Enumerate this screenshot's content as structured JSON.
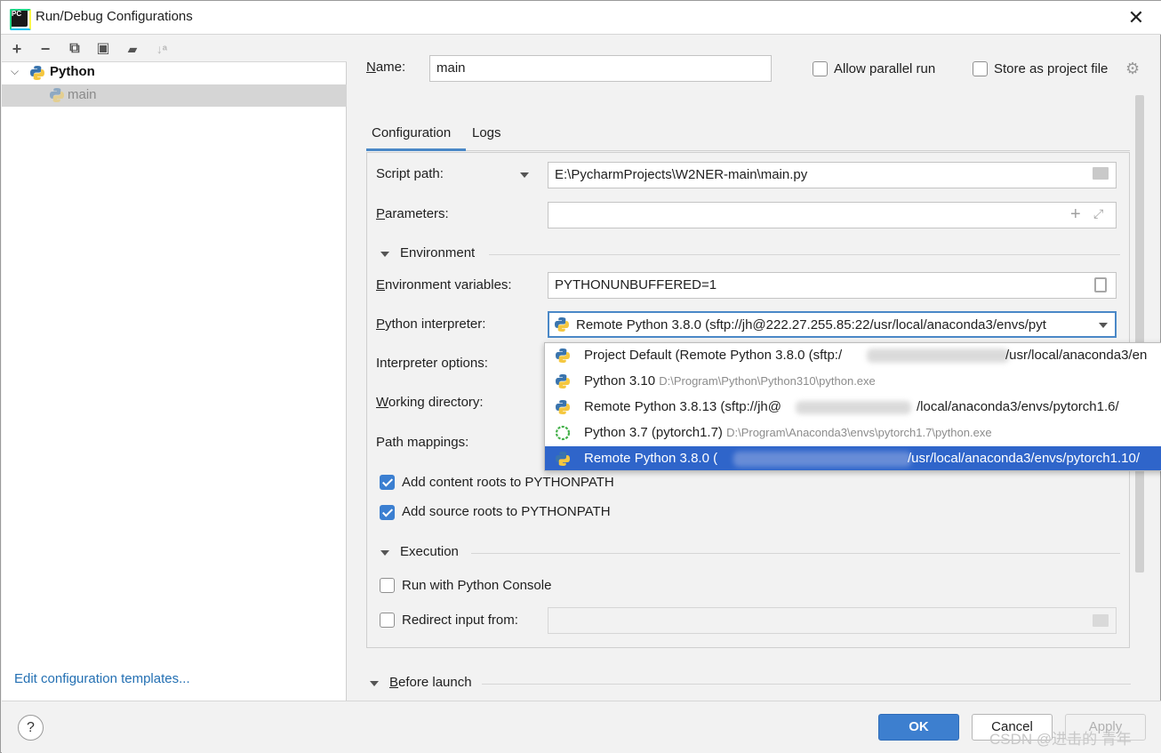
{
  "window": {
    "title": "Run/Debug Configurations",
    "close_glyph": "✕",
    "app_icon_text": "PC"
  },
  "left": {
    "toolbar": [
      {
        "name": "add-icon",
        "glyph": "+"
      },
      {
        "name": "remove-icon",
        "glyph": "−"
      },
      {
        "name": "copy-icon",
        "glyph": "⧉"
      },
      {
        "name": "save-icon",
        "glyph": "▣"
      },
      {
        "name": "new-folder-icon",
        "glyph": "▰"
      },
      {
        "name": "sort-icon",
        "glyph": "↓ᵃ"
      }
    ],
    "tree": {
      "group": "Python",
      "item": "main"
    },
    "templates_link": "Edit configuration templates..."
  },
  "form": {
    "name_label": "Name:",
    "name_value": "main",
    "allow_parallel": "Allow parallel run",
    "store_project": "Store as project file",
    "tabs": [
      "Configuration",
      "Logs"
    ],
    "script_path_label": "Script path:",
    "script_path_value": "E:\\PycharmProjects\\W2NER-main\\main.py",
    "parameters_label": "Parameters:",
    "parameters_value": "",
    "environment_section": "Environment",
    "env_vars_label": "Environment variables:",
    "env_vars_value": "PYTHONUNBUFFERED=1",
    "interpreter_label": "Python interpreter:",
    "interpreter_value": "Remote Python 3.8.0 (sftp://jh@222.27.255.85:22/usr/local/anaconda3/envs/pyt",
    "interpreter_options_label": "Interpreter options:",
    "working_dir_label": "Working directory:",
    "path_mappings_label": "Path mappings:",
    "content_roots": "Add content roots to PYTHONPATH",
    "source_roots": "Add source roots to PYTHONPATH",
    "execution_section": "Execution",
    "run_console": "Run with Python Console",
    "redirect_input": "Redirect input from:",
    "before_launch": "Before launch"
  },
  "dropdown": [
    {
      "name": "Project Default (Remote Python 3.8.0 (sftp:/",
      "path": "",
      "tail": "/usr/local/anaconda3/en",
      "icon": "remote",
      "blur": true,
      "selected": false
    },
    {
      "name": "Python 3.10",
      "path": "D:\\Program\\Python\\Python310\\python.exe",
      "tail": "",
      "icon": "python",
      "blur": false,
      "selected": false
    },
    {
      "name": "Remote Python 3.8.13 (sftp://jh@",
      "path": "",
      "tail": "/local/anaconda3/envs/pytorch1.6/",
      "icon": "remote",
      "blur": true,
      "selected": false
    },
    {
      "name": "Python 3.7 (pytorch1.7)",
      "path": "D:\\Program\\Anaconda3\\envs\\pytorch1.7\\python.exe",
      "tail": "",
      "icon": "conda",
      "blur": false,
      "selected": false
    },
    {
      "name": "Remote Python 3.8.0 (",
      "path": "",
      "tail": "/usr/local/anaconda3/envs/pytorch1.10/",
      "icon": "remote",
      "blur": true,
      "selected": true
    }
  ],
  "buttons": {
    "ok": "OK",
    "cancel": "Cancel",
    "apply": "Apply",
    "help": "?"
  },
  "watermark": "CSDN @进击的 青年"
}
